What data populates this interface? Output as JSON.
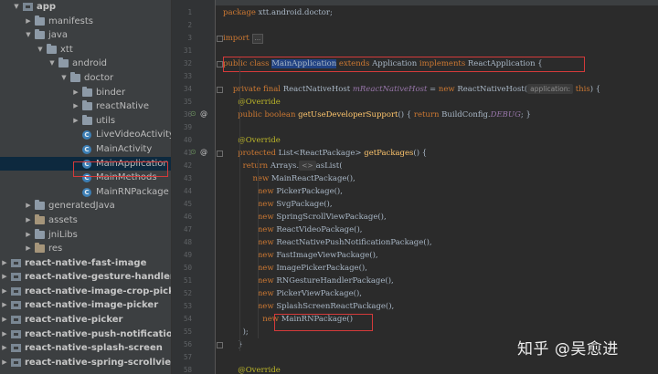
{
  "project_tree": {
    "rows": [
      {
        "label": "app",
        "indent": 1,
        "expanded": true,
        "icon": "module-folder-icon",
        "bold": true
      },
      {
        "label": "manifests",
        "indent": 2,
        "expanded": false,
        "icon": "folder-icon"
      },
      {
        "label": "java",
        "indent": 2,
        "expanded": true,
        "icon": "folder-icon"
      },
      {
        "label": "xtt",
        "indent": 3,
        "expanded": true,
        "icon": "folder-icon"
      },
      {
        "label": "android",
        "indent": 4,
        "expanded": true,
        "icon": "folder-icon"
      },
      {
        "label": "doctor",
        "indent": 5,
        "expanded": true,
        "icon": "folder-icon"
      },
      {
        "label": "binder",
        "indent": 6,
        "expanded": false,
        "icon": "folder-icon"
      },
      {
        "label": "reactNative",
        "indent": 6,
        "expanded": false,
        "icon": "folder-icon"
      },
      {
        "label": "utils",
        "indent": 6,
        "expanded": false,
        "icon": "folder-icon"
      },
      {
        "label": "LiveVideoActivity",
        "indent": 6,
        "icon": "class-icon"
      },
      {
        "label": "MainActivity",
        "indent": 6,
        "icon": "class-icon"
      },
      {
        "label": "MainApplication",
        "indent": 6,
        "icon": "class-icon",
        "selected": true
      },
      {
        "label": "MainMethods",
        "indent": 6,
        "icon": "class-icon"
      },
      {
        "label": "MainRNPackage",
        "indent": 6,
        "icon": "class-icon"
      },
      {
        "label": "generatedJava",
        "indent": 2,
        "expanded": false,
        "icon": "folder-icon"
      },
      {
        "label": "assets",
        "indent": 2,
        "expanded": false,
        "icon": "res-folder-icon"
      },
      {
        "label": "jniLibs",
        "indent": 2,
        "expanded": false,
        "icon": "folder-icon"
      },
      {
        "label": "res",
        "indent": 2,
        "expanded": false,
        "icon": "res-folder-icon"
      },
      {
        "label": "react-native-fast-image",
        "indent": 0,
        "expanded": false,
        "icon": "module-folder-icon",
        "bold": true
      },
      {
        "label": "react-native-gesture-handler",
        "indent": 0,
        "expanded": false,
        "icon": "module-folder-icon",
        "bold": true
      },
      {
        "label": "react-native-image-crop-picker",
        "indent": 0,
        "expanded": false,
        "icon": "module-folder-icon",
        "bold": true
      },
      {
        "label": "react-native-image-picker",
        "indent": 0,
        "expanded": false,
        "icon": "module-folder-icon",
        "bold": true
      },
      {
        "label": "react-native-picker",
        "indent": 0,
        "expanded": false,
        "icon": "module-folder-icon",
        "bold": true
      },
      {
        "label": "react-native-push-notification",
        "indent": 0,
        "expanded": false,
        "icon": "module-folder-icon",
        "bold": true
      },
      {
        "label": "react-native-splash-screen",
        "indent": 0,
        "expanded": false,
        "icon": "module-folder-icon",
        "bold": true
      },
      {
        "label": "react-native-spring-scrollview",
        "indent": 0,
        "expanded": false,
        "icon": "module-folder-icon",
        "bold": true
      }
    ]
  },
  "editor": {
    "lines": [
      {
        "n": "1",
        "parts": [
          [
            "kw",
            "package "
          ],
          [
            "",
            "xtt.android.doctor;"
          ]
        ]
      },
      {
        "n": "2",
        "parts": []
      },
      {
        "n": "3",
        "parts": [
          [
            "kw",
            "import "
          ],
          [
            "fold",
            "..."
          ]
        ]
      },
      {
        "n": "31",
        "parts": []
      },
      {
        "n": "32",
        "parts": [
          [
            "kw",
            "public class "
          ],
          [
            "hl",
            "MainApplication"
          ],
          [
            "kw",
            " extends "
          ],
          [
            "",
            "Application "
          ],
          [
            "kw",
            "implements "
          ],
          [
            "",
            "ReactApplication {"
          ]
        ]
      },
      {
        "n": "33",
        "parts": []
      },
      {
        "n": "34",
        "parts": [
          [
            "",
            "    "
          ],
          [
            "kw",
            "private final "
          ],
          [
            "",
            "ReactNativeHost "
          ],
          [
            "fld",
            "mReactNativeHost"
          ],
          [
            "",
            " = "
          ],
          [
            "kw",
            "new "
          ],
          [
            "",
            "ReactNativeHost("
          ],
          [
            "hint",
            "application:"
          ],
          [
            "kw",
            " this"
          ],
          [
            "",
            ") {"
          ]
        ]
      },
      {
        "n": "35",
        "parts": [
          [
            "",
            "      "
          ],
          [
            "ann",
            "@Override"
          ]
        ]
      },
      {
        "n": "36",
        "parts": [
          [
            "",
            "      "
          ],
          [
            "kw",
            "public boolean "
          ],
          [
            "fn",
            "getUseDeveloperSupport"
          ],
          [
            "",
            "() { "
          ],
          [
            "kw",
            "return "
          ],
          [
            "",
            "BuildConfig."
          ],
          [
            "fld",
            "DEBUG"
          ],
          [
            "",
            "; }"
          ]
        ]
      },
      {
        "n": "39",
        "parts": []
      },
      {
        "n": "40",
        "parts": [
          [
            "",
            "      "
          ],
          [
            "ann",
            "@Override"
          ]
        ]
      },
      {
        "n": "41",
        "parts": [
          [
            "",
            "      "
          ],
          [
            "kw",
            "protected "
          ],
          [
            "",
            "List<ReactPackage> "
          ],
          [
            "fn",
            "getPackages"
          ],
          [
            "",
            "() {"
          ]
        ]
      },
      {
        "n": "42",
        "parts": [
          [
            "",
            "        "
          ],
          [
            "kw",
            "return "
          ],
          [
            "",
            "Arrays."
          ],
          [
            "hint",
            "<>"
          ],
          [
            "",
            "asList("
          ]
        ]
      },
      {
        "n": "43",
        "parts": [
          [
            "",
            "            "
          ],
          [
            "kw",
            "new "
          ],
          [
            "",
            "MainReactPackage(),"
          ]
        ]
      },
      {
        "n": "44",
        "parts": [
          [
            "",
            "              "
          ],
          [
            "kw",
            "new "
          ],
          [
            "",
            "PickerPackage(),"
          ]
        ]
      },
      {
        "n": "45",
        "parts": [
          [
            "",
            "              "
          ],
          [
            "kw",
            "new "
          ],
          [
            "",
            "SvgPackage(),"
          ]
        ]
      },
      {
        "n": "46",
        "parts": [
          [
            "",
            "              "
          ],
          [
            "kw",
            "new "
          ],
          [
            "",
            "SpringScrollViewPackage(),"
          ]
        ]
      },
      {
        "n": "47",
        "parts": [
          [
            "",
            "              "
          ],
          [
            "kw",
            "new "
          ],
          [
            "",
            "ReactVideoPackage(),"
          ]
        ]
      },
      {
        "n": "48",
        "parts": [
          [
            "",
            "              "
          ],
          [
            "kw",
            "new "
          ],
          [
            "",
            "ReactNativePushNotificationPackage(),"
          ]
        ]
      },
      {
        "n": "49",
        "parts": [
          [
            "",
            "              "
          ],
          [
            "kw",
            "new "
          ],
          [
            "",
            "FastImageViewPackage(),"
          ]
        ]
      },
      {
        "n": "50",
        "parts": [
          [
            "",
            "              "
          ],
          [
            "kw",
            "new "
          ],
          [
            "",
            "ImagePickerPackage(),"
          ]
        ]
      },
      {
        "n": "51",
        "parts": [
          [
            "",
            "              "
          ],
          [
            "kw",
            "new "
          ],
          [
            "",
            "RNGestureHandlerPackage(),"
          ]
        ]
      },
      {
        "n": "52",
        "parts": [
          [
            "",
            "              "
          ],
          [
            "kw",
            "new "
          ],
          [
            "",
            "PickerViewPackage(),"
          ]
        ]
      },
      {
        "n": "53",
        "parts": [
          [
            "",
            "              "
          ],
          [
            "kw",
            "new "
          ],
          [
            "",
            "SplashScreenReactPackage(),"
          ]
        ]
      },
      {
        "n": "54",
        "parts": [
          [
            "",
            "                "
          ],
          [
            "kw",
            "new "
          ],
          [
            "",
            "MainRNPackage()"
          ]
        ]
      },
      {
        "n": "55",
        "parts": [
          [
            "",
            "        );"
          ]
        ]
      },
      {
        "n": "56",
        "parts": [
          [
            "",
            "      }"
          ]
        ]
      },
      {
        "n": "57",
        "parts": []
      },
      {
        "n": "58",
        "parts": [
          [
            "",
            "      "
          ],
          [
            "ann",
            "@Override"
          ]
        ]
      }
    ]
  },
  "watermark": "知乎 @吴愈进"
}
